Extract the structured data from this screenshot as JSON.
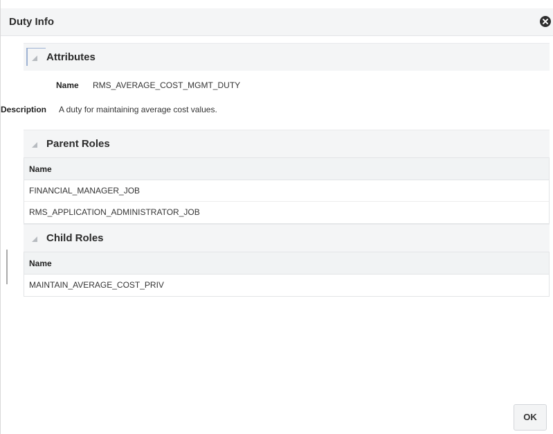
{
  "dialog": {
    "title": "Duty Info",
    "ok_label": "OK"
  },
  "attributes": {
    "title": "Attributes",
    "name_label": "Name",
    "name_value": "RMS_AVERAGE_COST_MGMT_DUTY",
    "description_label": "Description",
    "description_value": "A duty for maintaining average cost values."
  },
  "parent_roles": {
    "title": "Parent Roles",
    "column_header": "Name",
    "rows": [
      "FINANCIAL_MANAGER_JOB",
      "RMS_APPLICATION_ADMINISTRATOR_JOB"
    ]
  },
  "child_roles": {
    "title": "Child Roles",
    "column_header": "Name",
    "rows": [
      "MAINTAIN_AVERAGE_COST_PRIV"
    ]
  },
  "icons": {
    "close": "close-icon",
    "disclosure": "disclosure-triangle-icon"
  }
}
